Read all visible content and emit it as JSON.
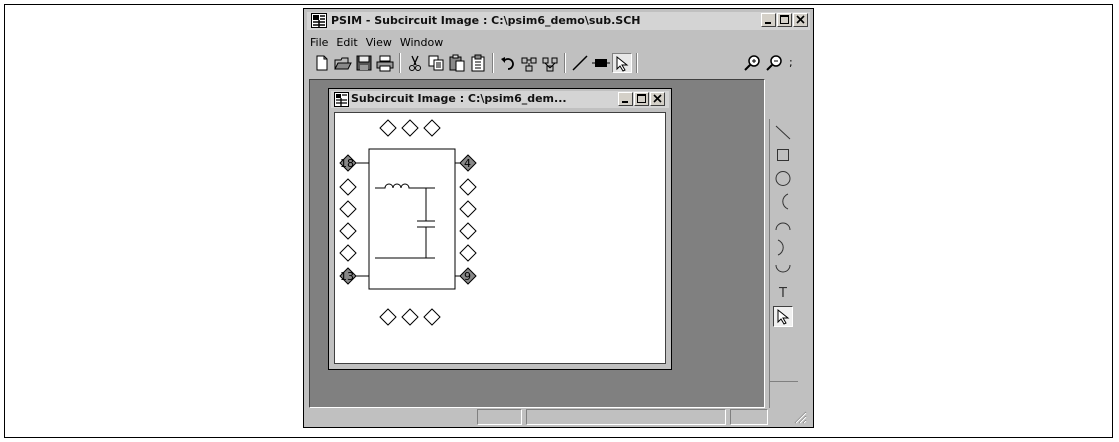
{
  "window": {
    "title": "PSIM - Subcircuit Image : C:\\psim6_demo\\sub.SCH",
    "controls": [
      "minimize",
      "maximize",
      "close"
    ]
  },
  "menu": {
    "items": [
      "File",
      "Edit",
      "View",
      "Window"
    ]
  },
  "toolbar": {
    "buttons": [
      "new-icon",
      "open-icon",
      "save-icon",
      "print-icon",
      "cut-icon",
      "copy-icon",
      "paste-icon",
      "clipboard-icon",
      "undo-icon",
      "escape-icon",
      "rotate-icon",
      "line-icon",
      "element-icon",
      "select-icon",
      "zoom-in-icon",
      "zoom-out-icon"
    ]
  },
  "child_window": {
    "title": "Subcircuit Image : C:\\psim6_dem...",
    "controls": [
      "minimize",
      "maximize",
      "close"
    ]
  },
  "schematic": {
    "pins": {
      "left_top": "18",
      "right_top": "4",
      "left_bottom": "13",
      "right_bottom": "9"
    }
  },
  "palette": {
    "tools": [
      "line-tool",
      "rectangle-tool",
      "circle-tool",
      "arc-left-tool",
      "arc-top-tool",
      "arc-right-tool",
      "arc-bottom-tool",
      "text-tool",
      "select-tool"
    ],
    "text_tool_label": "T"
  },
  "colors": {
    "chrome": "#c0c0c0",
    "workspace": "#808080",
    "canvas": "#ffffff",
    "titlebar": "#d4d4d4"
  }
}
